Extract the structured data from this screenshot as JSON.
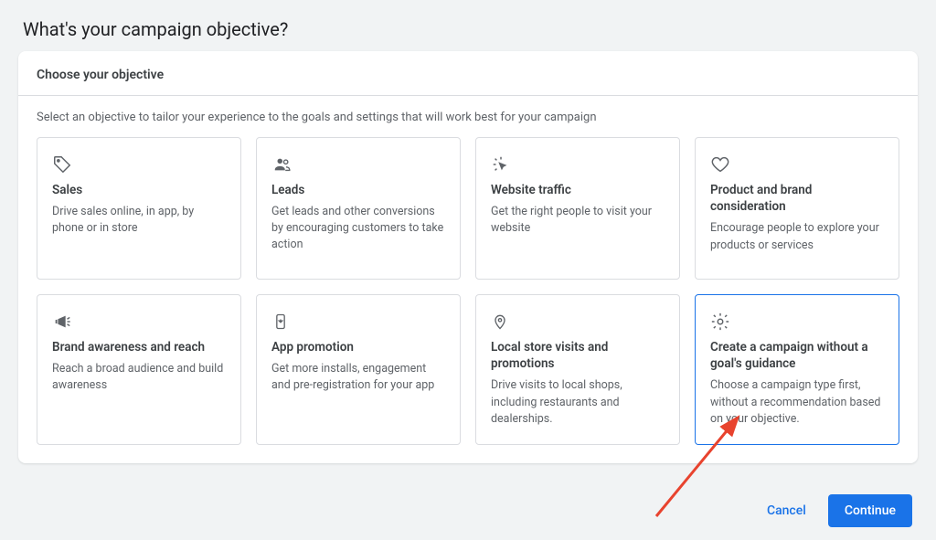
{
  "header_title": "What's your campaign objective?",
  "panel_title": "Choose your objective",
  "panel_subtext": "Select an objective to tailor your experience to the goals and settings that will work best for your campaign",
  "objectives": [
    {
      "icon": "tag",
      "title": "Sales",
      "desc": "Drive sales online, in app, by phone or in store",
      "selected": false
    },
    {
      "icon": "people",
      "title": "Leads",
      "desc": "Get leads and other conversions by encouraging customers to take action",
      "selected": false
    },
    {
      "icon": "click",
      "title": "Website traffic",
      "desc": "Get the right people to visit your website",
      "selected": false
    },
    {
      "icon": "heart",
      "title": "Product and brand consideration",
      "desc": "Encourage people to explore your products or services",
      "selected": false
    },
    {
      "icon": "megaphone",
      "title": "Brand awareness and reach",
      "desc": "Reach a broad audience and build awareness",
      "selected": false
    },
    {
      "icon": "phone",
      "title": "App promotion",
      "desc": "Get more installs, engagement and pre-registration for your app",
      "selected": false
    },
    {
      "icon": "pin",
      "title": "Local store visits and promotions",
      "desc": "Drive visits to local shops, including restaurants and dealerships.",
      "selected": false
    },
    {
      "icon": "gear",
      "title": "Create a campaign without a goal's guidance",
      "desc": "Choose a campaign type first, without a recommendation based on your objective.",
      "selected": true
    }
  ],
  "footer": {
    "cancel": "Cancel",
    "continue": "Continue"
  },
  "colors": {
    "primary": "#1a73e8",
    "arrow": "#e8432e"
  }
}
